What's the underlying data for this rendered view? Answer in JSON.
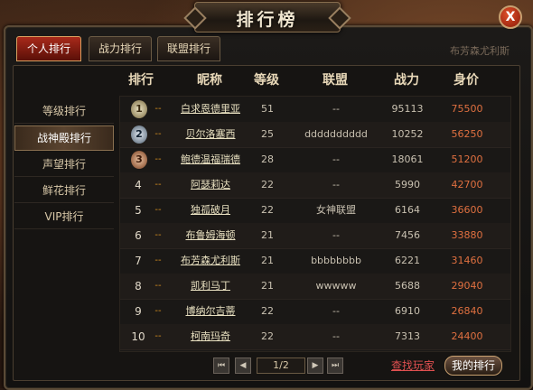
{
  "window": {
    "title": "排行榜",
    "close_glyph": "X"
  },
  "tabs": [
    {
      "label": "个人排行",
      "active": true
    },
    {
      "label": "战力排行",
      "active": false
    },
    {
      "label": "联盟排行",
      "active": false
    }
  ],
  "right_hint": "布芳森尤利斯",
  "sidebar": [
    {
      "label": "等级排行",
      "active": false
    },
    {
      "label": "战神殿排行",
      "active": true
    },
    {
      "label": "声望排行",
      "active": false
    },
    {
      "label": "鲜花排行",
      "active": false
    },
    {
      "label": "VIP排行",
      "active": false
    }
  ],
  "table": {
    "headers": [
      "排行",
      "昵称",
      "等级",
      "联盟",
      "战力",
      "身价"
    ],
    "rows": [
      {
        "rank": "1",
        "name": "白求恩德里亚",
        "level": "51",
        "alliance": "--",
        "power": "95113",
        "worth": "75500"
      },
      {
        "rank": "2",
        "name": "贝尔洛塞西",
        "level": "25",
        "alliance": "dddddddddd",
        "power": "10252",
        "worth": "56250"
      },
      {
        "rank": "3",
        "name": "鲍德温福瑞德",
        "level": "28",
        "alliance": "--",
        "power": "18061",
        "worth": "51200"
      },
      {
        "rank": "4",
        "name": "阿瑟莉达",
        "level": "22",
        "alliance": "--",
        "power": "5990",
        "worth": "42700"
      },
      {
        "rank": "5",
        "name": "独孤破月",
        "level": "22",
        "alliance": "女神联盟",
        "power": "6164",
        "worth": "36600"
      },
      {
        "rank": "6",
        "name": "布鲁姆海顿",
        "level": "21",
        "alliance": "--",
        "power": "7456",
        "worth": "33880"
      },
      {
        "rank": "7",
        "name": "布芳森尤利斯",
        "level": "21",
        "alliance": "bbbbbbbb",
        "power": "6221",
        "worth": "31460"
      },
      {
        "rank": "8",
        "name": "凯利马丁",
        "level": "21",
        "alliance": "wwwww",
        "power": "5688",
        "worth": "29040"
      },
      {
        "rank": "9",
        "name": "博纳尔吉蒂",
        "level": "22",
        "alliance": "--",
        "power": "6910",
        "worth": "26840"
      },
      {
        "rank": "10",
        "name": "柯南玛奇",
        "level": "22",
        "alliance": "--",
        "power": "7313",
        "worth": "24400"
      }
    ],
    "rank_dash": "--"
  },
  "pager": {
    "page": "1/2",
    "first_glyph": "⏮",
    "prev_glyph": "◀",
    "next_glyph": "▶",
    "last_glyph": "⏭"
  },
  "footer": {
    "find_player": "查找玩家",
    "my_rank": "我的排行"
  },
  "colors": {
    "worth": "#e07040",
    "dash": "#d89020",
    "active_tab": "#a82a1a"
  }
}
